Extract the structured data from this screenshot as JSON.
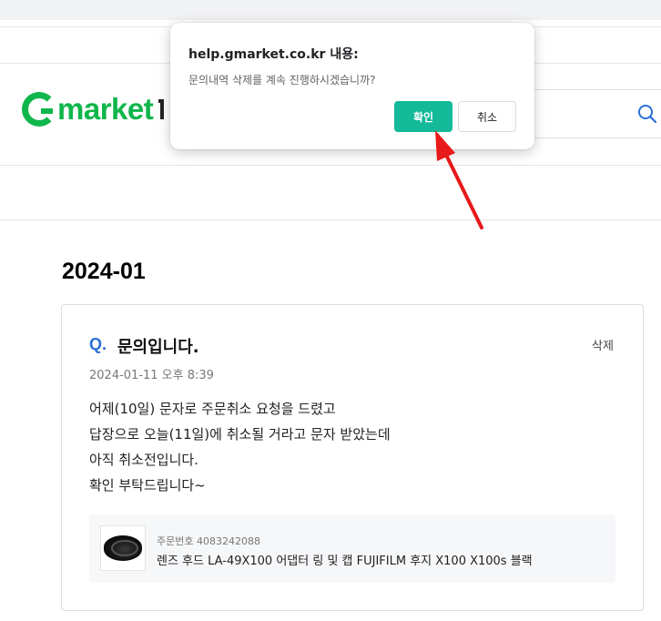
{
  "header": {
    "logo_text": "market"
  },
  "dialog": {
    "title": "help.gmarket.co.kr 내용:",
    "message": "문의내역 삭제를 계속 진행하시겠습니까?",
    "ok_label": "확인",
    "cancel_label": "취소"
  },
  "section": {
    "date_heading": "2024-01"
  },
  "inquiry": {
    "q_mark": "Q.",
    "title": "문의입니다.",
    "delete_label": "삭제",
    "datetime": "2024-01-11 오후 8:39",
    "body_lines": [
      "어제(10일) 문자로 주문취소 요청을 드렸고",
      "답장으로 오늘(11일)에 취소될 거라고 문자 받았는데",
      "아직 취소전입니다.",
      "확인 부탁드립니다~"
    ],
    "order": {
      "order_number": "주문번호 4083242088",
      "product_name": "렌즈 후드 LA-49X100 어댑터 링 및 캡 FUJIFILM 후지 X100 X100s 블랙"
    }
  },
  "colors": {
    "brand_green": "#0fb64b",
    "ok_button": "#13b999",
    "q_mark": "#2a6fd6",
    "arrow": "#e8191b"
  }
}
